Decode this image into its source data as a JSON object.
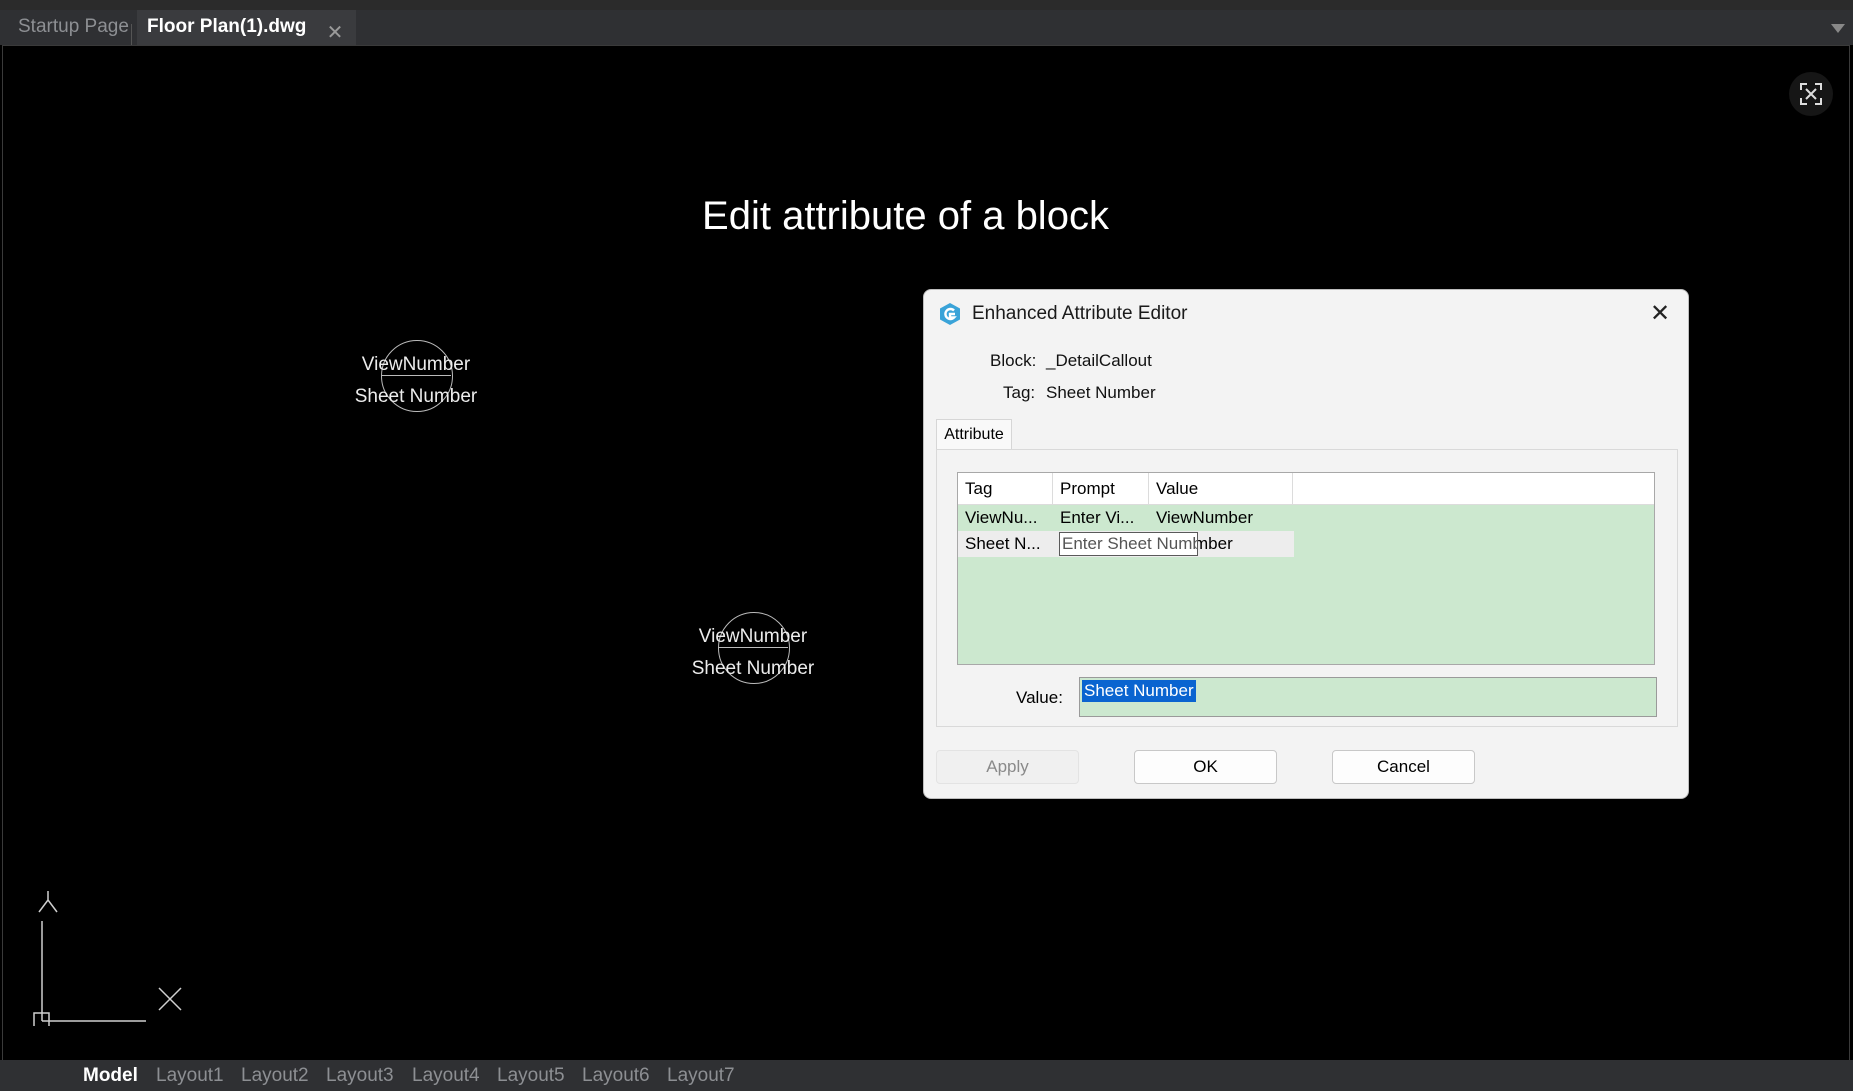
{
  "tabs": {
    "startup": "Startup Page",
    "active": "Floor Plan(1).dwg",
    "close_glyph": "✕"
  },
  "canvas": {
    "title": "Edit attribute of a block",
    "blocks": [
      {
        "line1": "ViewNumber",
        "line2": "Sheet Number"
      },
      {
        "line1": "ViewNumber",
        "line2": "Sheet Number"
      }
    ],
    "ucs": {
      "x_label": "X",
      "y_label": "Y"
    }
  },
  "layouts": [
    "Model",
    "Layout1",
    "Layout2",
    "Layout3",
    "Layout4",
    "Layout5",
    "Layout6",
    "Layout7"
  ],
  "dialog": {
    "title": "Enhanced Attribute Editor",
    "icon": "app-logo-icon",
    "close_glyph": "✕",
    "block_label": "Block:",
    "block_value": "_DetailCallout",
    "tag_label": "Tag:",
    "tag_value": "Sheet Number",
    "tab_label": "Attribute",
    "table": {
      "headers": [
        "Tag",
        "Prompt",
        "Value"
      ],
      "rows": [
        {
          "tag": "ViewNu...",
          "prompt": "Enter Vi...",
          "value": "ViewNumber"
        },
        {
          "tag": "Sheet N...",
          "prompt": "Enter Sheet Number",
          "value": "mber"
        }
      ]
    },
    "value_label": "Value:",
    "value_text": "Sheet Number",
    "buttons": {
      "apply": "Apply",
      "ok": "OK",
      "cancel": "Cancel"
    }
  },
  "colors": {
    "canvas_bg": "#000000",
    "table_bg": "#cce8cf",
    "selection": "#0a64d0"
  }
}
